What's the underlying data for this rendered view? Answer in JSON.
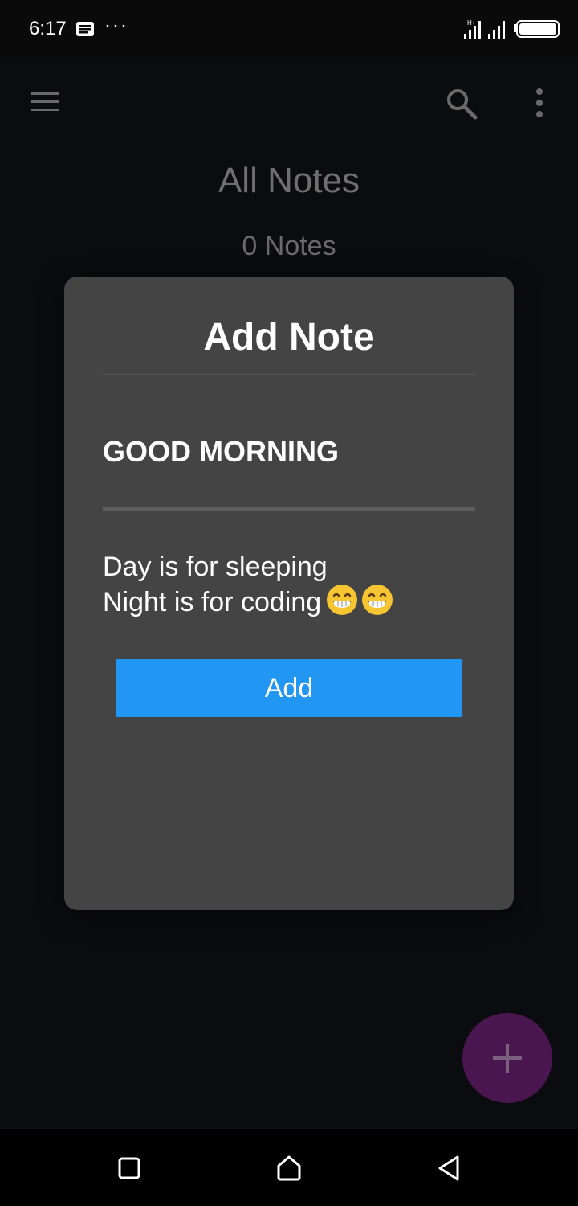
{
  "status_bar": {
    "time": "6:17",
    "more": "···",
    "icons": [
      "message-icon",
      "signal-icon",
      "battery-icon"
    ]
  },
  "app_bar": {
    "icons": [
      "menu-icon",
      "search-icon",
      "overflow-menu-icon"
    ]
  },
  "page": {
    "title": "All Notes",
    "count": "0 Notes"
  },
  "dialog": {
    "title": "Add Note",
    "note_title": "GOOD MORNING",
    "note_body_line1": "Day is for sleeping",
    "note_body_line2": "Night is for coding",
    "add_label": "Add"
  },
  "fab": {
    "icon": "plus-icon",
    "color": "#4a1650"
  },
  "colors": {
    "accent": "#2196f3",
    "dialog_bg": "#444444",
    "background": "#0b0c0f"
  },
  "nav_bar": {
    "icons": [
      "recent-apps-icon",
      "home-icon",
      "back-icon"
    ]
  }
}
